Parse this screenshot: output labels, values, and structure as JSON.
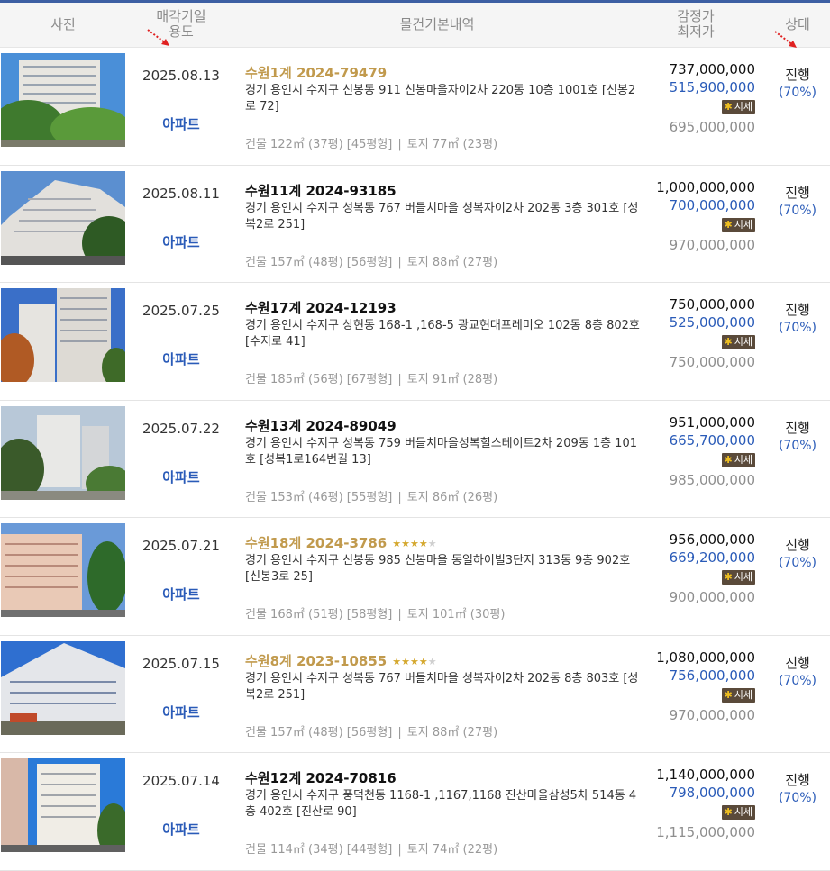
{
  "header": {
    "photo": "사진",
    "date_line1": "매각기일",
    "date_line2": "용도",
    "info": "물건기본내역",
    "price_line1": "감정가",
    "price_line2": "최저가",
    "status": "상태"
  },
  "quote_label": "시세",
  "quote_mark": "✱",
  "colors": {
    "accent": "#2a5bb8",
    "gold": "#c19a4d",
    "arrow": "#e02020"
  },
  "rows": [
    {
      "date": "2025.08.13",
      "usage": "아파트",
      "case": "수원1계 2024-79479",
      "gold": true,
      "stars": 0,
      "address": "경기 용인시 수지구 신봉동 911 신봉마을자이2차 220동 10층 1001호 [신봉2로 72]",
      "building": "건물 122㎡ (37평) [45평형]",
      "land": "토지 77㎡ (23평)",
      "appraisal": "737,000,000",
      "minimum": "515,900,000",
      "market": "695,000,000",
      "status": "진행",
      "percent": "(70%)"
    },
    {
      "date": "2025.08.11",
      "usage": "아파트",
      "case": "수원11계 2024-93185",
      "gold": false,
      "stars": 0,
      "address": "경기 용인시 수지구 성복동 767 버들치마을 성복자이2차 202동 3층 301호 [성복2로 251]",
      "building": "건물 157㎡ (48평) [56평형]",
      "land": "토지 88㎡ (27평)",
      "appraisal": "1,000,000,000",
      "minimum": "700,000,000",
      "market": "970,000,000",
      "status": "진행",
      "percent": "(70%)"
    },
    {
      "date": "2025.07.25",
      "usage": "아파트",
      "case": "수원17계 2024-12193",
      "gold": false,
      "stars": 0,
      "address": "경기 용인시 수지구 상현동 168-1 ,168-5 광교현대프레미오 102동 8층 802호 [수지로 41]",
      "building": "건물 185㎡ (56평) [67평형]",
      "land": "토지 91㎡ (28평)",
      "appraisal": "750,000,000",
      "minimum": "525,000,000",
      "market": "750,000,000",
      "status": "진행",
      "percent": "(70%)"
    },
    {
      "date": "2025.07.22",
      "usage": "아파트",
      "case": "수원13계 2024-89049",
      "gold": false,
      "stars": 0,
      "address": "경기 용인시 수지구 성복동 759 버들치마을성복힐스테이트2차 209동 1층 101호 [성복1로164번길 13]",
      "building": "건물 153㎡ (46평) [55평형]",
      "land": "토지 86㎡ (26평)",
      "appraisal": "951,000,000",
      "minimum": "665,700,000",
      "market": "985,000,000",
      "status": "진행",
      "percent": "(70%)"
    },
    {
      "date": "2025.07.21",
      "usage": "아파트",
      "case": "수원18계 2024-3786",
      "gold": true,
      "stars": 4,
      "address": "경기 용인시 수지구 신봉동 985 신봉마을 동일하이빌3단지 313동 9층 902호 [신봉3로 25]",
      "building": "건물 168㎡ (51평) [58평형]",
      "land": "토지 101㎡ (30평)",
      "appraisal": "956,000,000",
      "minimum": "669,200,000",
      "market": "900,000,000",
      "status": "진행",
      "percent": "(70%)"
    },
    {
      "date": "2025.07.15",
      "usage": "아파트",
      "case": "수원8계 2023-10855",
      "gold": true,
      "stars": 4,
      "address": "경기 용인시 수지구 성복동 767 버들치마을 성복자이2차 202동 8층 803호 [성복2로 251]",
      "building": "건물 157㎡ (48평) [56평형]",
      "land": "토지 88㎡ (27평)",
      "appraisal": "1,080,000,000",
      "minimum": "756,000,000",
      "market": "970,000,000",
      "status": "진행",
      "percent": "(70%)"
    },
    {
      "date": "2025.07.14",
      "usage": "아파트",
      "case": "수원12계 2024-70816",
      "gold": false,
      "stars": 0,
      "address": "경기 용인시 수지구 풍덕천동 1168-1 ,1167,1168 진산마을삼성5차 514동 4층 402호 [진산로 90]",
      "building": "건물 114㎡ (34평) [44평형]",
      "land": "토지 74㎡ (22평)",
      "appraisal": "1,140,000,000",
      "minimum": "798,000,000",
      "market": "1,115,000,000",
      "status": "진행",
      "percent": "(70%)"
    }
  ]
}
